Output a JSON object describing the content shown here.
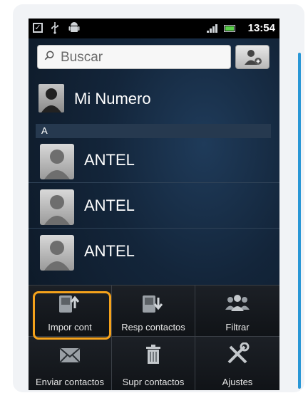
{
  "status_bar": {
    "time": "13:54",
    "icons": [
      "checkbox-icon",
      "usb-icon",
      "android-icon",
      "signal-icon",
      "battery-icon"
    ]
  },
  "search": {
    "placeholder": "Buscar"
  },
  "me": {
    "label": "Mi Numero"
  },
  "section": {
    "letter": "A"
  },
  "contacts": [
    {
      "name": "ANTEL"
    },
    {
      "name": "ANTEL"
    },
    {
      "name": "ANTEL"
    }
  ],
  "menu": {
    "items": [
      {
        "label": "Impor cont",
        "icon": "import-contacts-icon"
      },
      {
        "label": "Resp contactos",
        "icon": "backup-contacts-icon"
      },
      {
        "label": "Filtrar",
        "icon": "filter-people-icon"
      },
      {
        "label": "Enviar contactos",
        "icon": "envelope-icon"
      },
      {
        "label": "Supr contactos",
        "icon": "trash-icon"
      },
      {
        "label": "Ajustes",
        "icon": "settings-tools-icon"
      }
    ]
  },
  "colors": {
    "highlight": "#f5a21b",
    "accent": "#2a97d6",
    "battery": "#5ad04a"
  }
}
